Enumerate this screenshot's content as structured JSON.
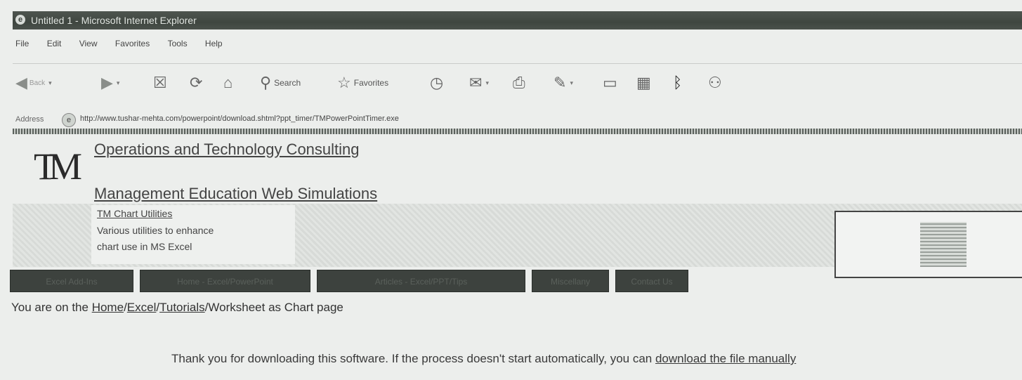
{
  "window": {
    "title": "Untitled 1 - Microsoft Internet Explorer"
  },
  "menu": [
    "File",
    "Edit",
    "View",
    "Favorites",
    "Tools",
    "Help"
  ],
  "toolbar": {
    "back_label": "Back",
    "search_label": "Search",
    "favorites_label": "Favorites"
  },
  "address": {
    "label": "Address",
    "url": "http://www.tushar-mehta.com/powerpoint/download.shtml?ppt_timer/TMPowerPointTimer.exe"
  },
  "site": {
    "logo": "TM",
    "link1": "Operations and Technology Consulting",
    "link2": "Management Education Web Simulations"
  },
  "ad": {
    "title": "TM Chart Utilities",
    "line1": "Various utilities to enhance",
    "line2": "chart use in MS Excel"
  },
  "nav": [
    "Excel Add-Ins",
    "Home - Excel/PowerPoint",
    "Articles - Excel/PPT/Tips",
    "Miscellany",
    "Contact Us"
  ],
  "breadcrumb": {
    "prefix": "You are on the ",
    "home": "Home",
    "excel": "Excel",
    "tutorials": "Tutorials",
    "suffix": "Worksheet as Chart page"
  },
  "thanks": {
    "text": "Thank you for downloading this software.  If the process doesn't start automatically, you can ",
    "link": "download the file manually"
  }
}
